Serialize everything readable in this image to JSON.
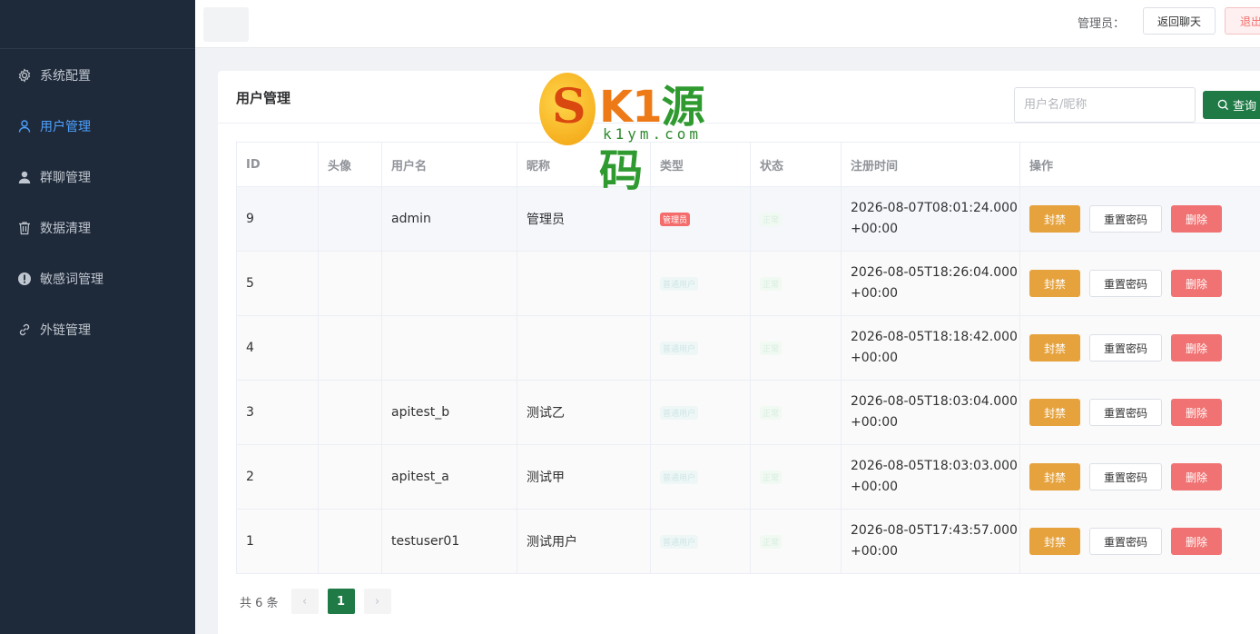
{
  "sidebar": {
    "items": [
      {
        "label": "系统配置",
        "icon": "gear-icon",
        "active": false
      },
      {
        "label": "用户管理",
        "icon": "user-icon",
        "active": true
      },
      {
        "label": "群聊管理",
        "icon": "person-icon",
        "active": false
      },
      {
        "label": "数据清理",
        "icon": "trash-icon",
        "active": false
      },
      {
        "label": "敏感词管理",
        "icon": "warning-icon",
        "active": false
      },
      {
        "label": "外链管理",
        "icon": "link-icon",
        "active": false
      }
    ]
  },
  "header": {
    "admin_label": "管理员：",
    "back_button": "返回聊天",
    "exit_button": "退出"
  },
  "page": {
    "title": "用户管理",
    "search_placeholder": "用户名/昵称",
    "search_button": "查询"
  },
  "watermark": {
    "main_k": "K1",
    "main_cn": "源码",
    "sub": "k1ym.com"
  },
  "table": {
    "headers": {
      "id": "ID",
      "avatar": "头像",
      "username": "用户名",
      "nickname": "昵称",
      "type": "类型",
      "status": "状态",
      "registered": "注册时间",
      "actions": "操作"
    },
    "rows": [
      {
        "id": "9",
        "username": "admin",
        "nickname": "管理员",
        "type": "管理员",
        "status": "正常",
        "time1": "2026-08-07T08:01:24.000",
        "time2": "+00:00"
      },
      {
        "id": "5",
        "username": "",
        "nickname": "",
        "type": "普通用户",
        "status": "正常",
        "time1": "2026-08-05T18:26:04.000",
        "time2": "+00:00"
      },
      {
        "id": "4",
        "username": "",
        "nickname": "",
        "type": "普通用户",
        "status": "正常",
        "time1": "2026-08-05T18:18:42.000",
        "time2": "+00:00"
      },
      {
        "id": "3",
        "username": "apitest_b",
        "nickname": "测试乙",
        "type": "普通用户",
        "status": "正常",
        "time1": "2026-08-05T18:03:04.000",
        "time2": "+00:00"
      },
      {
        "id": "2",
        "username": "apitest_a",
        "nickname": "测试甲",
        "type": "普通用户",
        "status": "正常",
        "time1": "2026-08-05T18:03:03.000",
        "time2": "+00:00"
      },
      {
        "id": "1",
        "username": "testuser01",
        "nickname": "测试用户",
        "type": "普通用户",
        "status": "正常",
        "time1": "2026-08-05T17:43:57.000",
        "time2": "+00:00"
      }
    ],
    "action_labels": {
      "ban": "封禁",
      "reset": "重置密码",
      "delete": "删除"
    }
  },
  "pagination": {
    "total_text": "共 6 条",
    "current_page": "1",
    "prev_icon": "‹",
    "next_icon": "›"
  },
  "colors": {
    "sidebar_bg": "#1e2a3a",
    "accent_green": "#1f7a46",
    "ban": "#e6a23c",
    "delete": "#f07272",
    "active_nav": "#4ea1ff"
  }
}
